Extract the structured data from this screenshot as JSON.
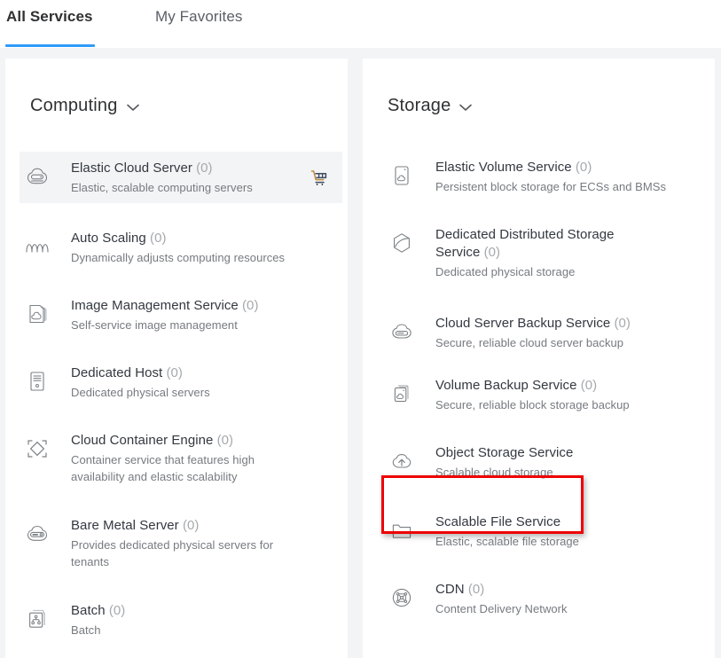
{
  "tabs": [
    {
      "label": "All Services",
      "active": true
    },
    {
      "label": "My Favorites",
      "active": false
    }
  ],
  "colors": {
    "accent": "#2f9bfa",
    "highlight": "#ef0000",
    "title": "#303133",
    "desc": "#767a80",
    "count": "#a6a9ad",
    "row_hover_bg": "#f3f4f5",
    "page_bg": "#f2f4f5",
    "panel_bg": "#ffffff"
  },
  "columns": [
    {
      "header": "Computing",
      "chevron_icon": "chevron-down-icon",
      "services": [
        {
          "name": "Elastic Cloud Server",
          "count": "(0)",
          "desc": "Elastic, scalable computing servers",
          "icon": "elastic-cloud-server-icon",
          "hover": true,
          "cart": "shopping-cart-icon"
        },
        {
          "name": "Auto Scaling",
          "count": "(0)",
          "desc": "Dynamically adjusts computing resources",
          "icon": "auto-scaling-icon"
        },
        {
          "name": "Image Management Service",
          "count": "(0)",
          "desc": "Self-service image management",
          "icon": "image-management-icon"
        },
        {
          "name": "Dedicated Host",
          "count": "(0)",
          "desc": "Dedicated physical servers",
          "icon": "dedicated-host-icon"
        },
        {
          "name": "Cloud Container Engine",
          "count": "(0)",
          "desc": "Container service that features high availability and elastic scalability",
          "icon": "cloud-container-engine-icon"
        },
        {
          "name": "Bare Metal Server",
          "count": "(0)",
          "desc": "Provides dedicated physical servers for tenants",
          "icon": "bare-metal-server-icon"
        },
        {
          "name": "Batch",
          "count": "(0)",
          "desc": "Batch",
          "icon": "batch-icon"
        }
      ]
    },
    {
      "header": "Storage",
      "chevron_icon": "chevron-down-icon",
      "services": [
        {
          "name": "Elastic Volume Service",
          "count": "(0)",
          "desc": "Persistent block storage for ECSs and BMSs",
          "icon": "elastic-volume-service-icon"
        },
        {
          "name": "Dedicated Distributed Storage Service",
          "count": "(0)",
          "desc": "Dedicated physical storage",
          "icon": "dedicated-distributed-storage-icon"
        },
        {
          "name": "Cloud Server Backup Service",
          "count": "(0)",
          "desc": "Secure, reliable cloud server backup",
          "icon": "cloud-server-backup-icon"
        },
        {
          "name": "Volume Backup Service",
          "count": "(0)",
          "desc": "Secure, reliable block storage backup",
          "icon": "volume-backup-icon"
        },
        {
          "name": "Object Storage Service",
          "count": "",
          "desc": "Scalable cloud storage",
          "icon": "object-storage-service-icon",
          "highlighted": true
        },
        {
          "name": "Scalable File Service",
          "count": "",
          "desc": "Elastic, scalable file storage",
          "icon": "scalable-file-service-icon"
        },
        {
          "name": "CDN",
          "count": "(0)",
          "desc": "Content Delivery Network",
          "icon": "cdn-icon"
        }
      ]
    }
  ]
}
